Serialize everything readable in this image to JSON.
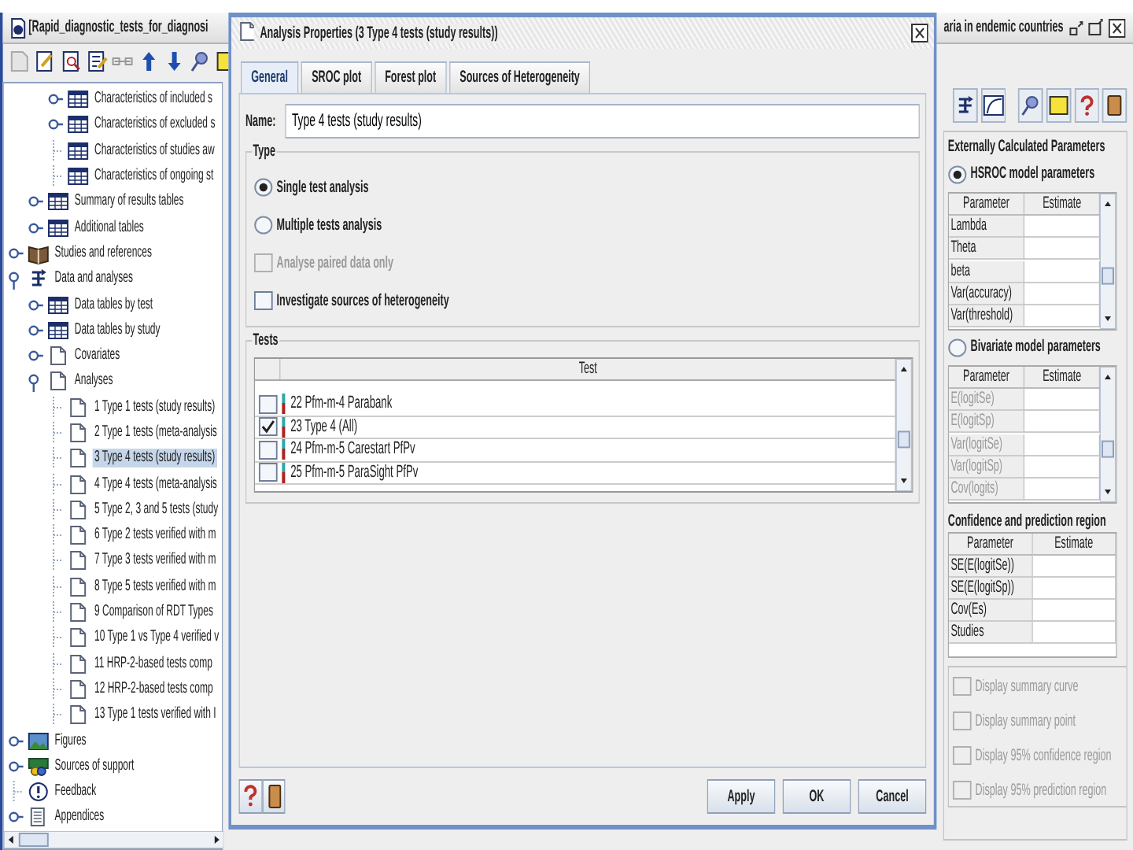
{
  "app_window": {
    "title": "[Rapid_diagnostic_tests_for_diagnosi",
    "doc_title": "aria in endemic countries"
  },
  "tree": [
    {
      "children": [
        {
          "children": [
            {
              "label": "Characteristics of included s",
              "kind": "table",
              "expanded": false,
              "selected": false
            },
            {
              "label": "Characteristics of excluded s",
              "kind": "table",
              "expanded": false,
              "selected": false
            },
            {
              "label": "Characteristics of studies aw",
              "kind": "table",
              "selected": false
            },
            {
              "label": "Characteristics of ongoing st",
              "kind": "table",
              "selected": false
            }
          ]
        },
        {
          "label": "Summary of results tables",
          "kind": "table",
          "expanded": false,
          "selected": false
        },
        {
          "label": "Additional tables",
          "kind": "table",
          "expanded": false,
          "selected": false
        }
      ]
    },
    {
      "label": "Studies and references",
      "kind": "book",
      "expanded": false,
      "selected": false
    },
    {
      "label": "Data and analyses",
      "kind": "data",
      "expanded": true,
      "selected": false,
      "children": [
        {
          "label": "Data tables by test",
          "kind": "table",
          "expanded": false,
          "selected": false
        },
        {
          "label": "Data tables by study",
          "kind": "table",
          "expanded": false,
          "selected": false
        },
        {
          "label": "Covariates",
          "kind": "page",
          "expanded": false,
          "selected": false
        },
        {
          "label": "Analyses",
          "kind": "page",
          "expanded": true,
          "selected": false,
          "children": [
            {
              "label": "1 Type 1 tests (study results)",
              "kind": "page",
              "selected": false
            },
            {
              "label": "2 Type 1 tests (meta-analysis",
              "kind": "page",
              "selected": false
            },
            {
              "label": "3 Type 4 tests (study results)",
              "kind": "page",
              "selected": true
            },
            {
              "label": "4 Type 4 tests (meta-analysis",
              "kind": "page",
              "selected": false
            },
            {
              "label": "5 Type 2, 3 and 5 tests (study",
              "kind": "page",
              "selected": false
            },
            {
              "label": "6 Type 2 tests verified with m",
              "kind": "page",
              "selected": false
            },
            {
              "label": "7 Type 3 tests verified with m",
              "kind": "page",
              "selected": false
            },
            {
              "label": "8 Type 5 tests verified with m",
              "kind": "page",
              "selected": false
            },
            {
              "label": "9 Comparison of RDT Types",
              "kind": "page",
              "selected": false
            },
            {
              "label": "10 Type 1 vs Type 4 verified v",
              "kind": "page",
              "selected": false
            },
            {
              "label": "11 HRP-2-based tests comp",
              "kind": "page",
              "selected": false
            },
            {
              "label": "12 HRP-2-based tests comp",
              "kind": "page",
              "selected": false
            },
            {
              "label": "13 Type 1 tests verified with I",
              "kind": "page",
              "selected": false
            }
          ]
        }
      ]
    },
    {
      "label": "Figures",
      "kind": "figure",
      "expanded": false,
      "selected": false
    },
    {
      "label": "Sources of support",
      "kind": "support",
      "expanded": false,
      "selected": false
    },
    {
      "label": "Feedback",
      "kind": "feedback",
      "selected": false
    },
    {
      "label": "Appendices",
      "kind": "appendix",
      "expanded": false,
      "selected": false
    }
  ],
  "dialog": {
    "title": "Analysis Properties (3 Type 4 tests (study results))",
    "tabs": [
      {
        "label": "General",
        "selected": true
      },
      {
        "label": "SROC plot",
        "selected": false
      },
      {
        "label": "Forest plot",
        "selected": false
      },
      {
        "label": "Sources of Heterogeneity",
        "selected": false
      }
    ],
    "name_label": "Name:",
    "name_value": "Type 4 tests (study results)",
    "type_group": "Type",
    "options": [
      {
        "kind": "radio",
        "label": "Single test analysis",
        "checked": true,
        "disabled": false
      },
      {
        "kind": "radio",
        "label": "Multiple tests analysis",
        "checked": false,
        "disabled": false
      },
      {
        "kind": "checkbox",
        "label": "Analyse paired data only",
        "checked": false,
        "disabled": true
      },
      {
        "kind": "checkbox",
        "label": "Investigate sources of heterogeneity",
        "checked": false,
        "disabled": false
      }
    ],
    "tests_group": "Tests",
    "tests_column": "Test",
    "tests": [
      {
        "label": "22 Pfm-m-4 Parabank",
        "checked": false
      },
      {
        "label": "23 Type 4 (All)",
        "checked": true
      },
      {
        "label": "24 Pfm-m-5 Carestart PfPv",
        "checked": false
      },
      {
        "label": "25 Pfm-m-5 ParaSight PfPv",
        "checked": false
      }
    ],
    "buttons": [
      "Apply",
      "OK",
      "Cancel"
    ]
  },
  "right_panel": {
    "group_title": "Externally Calculated Parameters",
    "models": [
      {
        "label": "HSROC model parameters",
        "selected": true,
        "columns": [
          "Parameter",
          "Estimate"
        ],
        "rows": [
          "Lambda",
          "Theta",
          "beta",
          "Var(accuracy)",
          "Var(threshold)"
        ]
      },
      {
        "label": "Bivariate model parameters",
        "selected": false,
        "columns": [
          "Parameter",
          "Estimate"
        ],
        "rows": [
          "E(logitSe)",
          "E(logitSp)",
          "Var(logitSe)",
          "Var(logitSp)",
          "Cov(logits)"
        ]
      }
    ],
    "confidence_title": "Confidence and prediction region",
    "confidence_table": {
      "columns": [
        "Parameter",
        "Estimate"
      ],
      "rows": [
        "SE(E(logitSe))",
        "SE(E(logitSp))",
        "Cov(Es)",
        "Studies"
      ]
    },
    "display_options": [
      {
        "label": "Display summary curve",
        "checked": false,
        "disabled": true
      },
      {
        "label": "Display summary point",
        "checked": false,
        "disabled": true
      },
      {
        "label": "Display 95% confidence region",
        "checked": false,
        "disabled": true
      },
      {
        "label": "Display 95% prediction region",
        "checked": false,
        "disabled": true
      }
    ]
  }
}
